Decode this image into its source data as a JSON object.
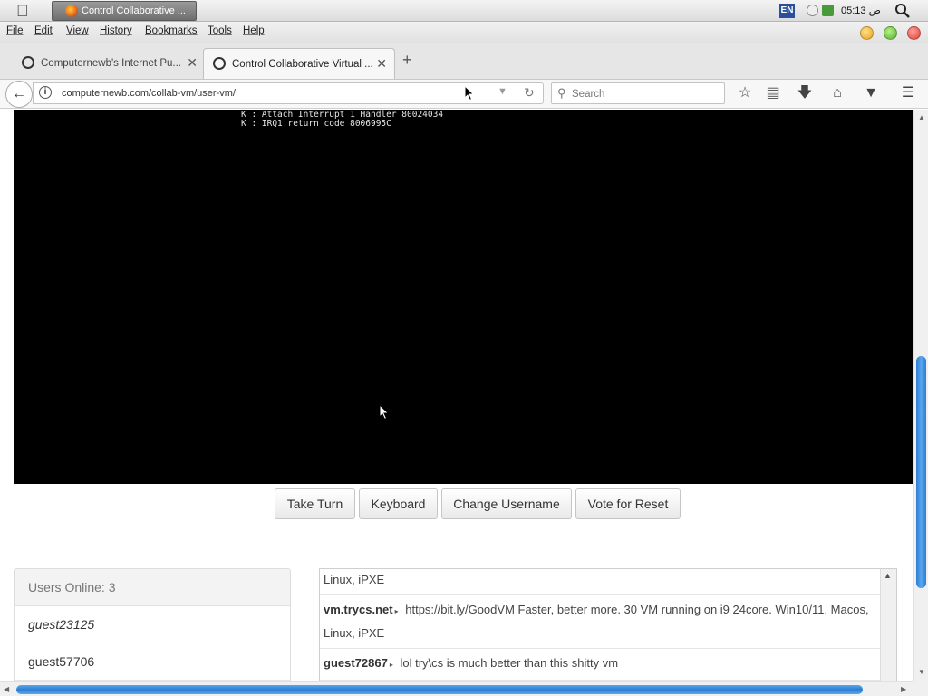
{
  "system": {
    "taskbar_title": "Control Collaborative ...",
    "keyboard_layout": "EN",
    "clock": "05:13 ص"
  },
  "menu": [
    "File",
    "Edit",
    "View",
    "History",
    "Bookmarks",
    "Tools",
    "Help"
  ],
  "tabs": [
    {
      "label": "Computernewb's Internet Pu...",
      "active": false
    },
    {
      "label": "Control Collaborative Virtual ...",
      "active": true
    }
  ],
  "nav": {
    "url": "computernewb.com/collab-vm/user-vm/",
    "search_placeholder": "Search"
  },
  "vm": {
    "console_lines": [
      "K : Attach Interrupt 1 Handler 80024034",
      "K : IRQ1 return code 8006995C"
    ],
    "buttons": [
      "Take Turn",
      "Keyboard",
      "Change Username",
      "Vote for Reset"
    ]
  },
  "users": {
    "header": "Users Online: 3",
    "list": [
      "guest23125",
      "guest57706"
    ]
  },
  "chat": {
    "messages": [
      {
        "user": "",
        "text": "Linux, iPXE"
      },
      {
        "user": "vm.trycs.net",
        "text": "https://bit.ly/GoodVM Faster, better more. 30 VM running on i9 24core. Win10/11, Macos, Linux, iPXE"
      },
      {
        "user": "guest72867",
        "text": "lol try\\cs is much better than this shitty vm"
      }
    ]
  },
  "colors": {
    "scroll_thumb": "#2d7dd2",
    "vm_background": "#000000"
  }
}
